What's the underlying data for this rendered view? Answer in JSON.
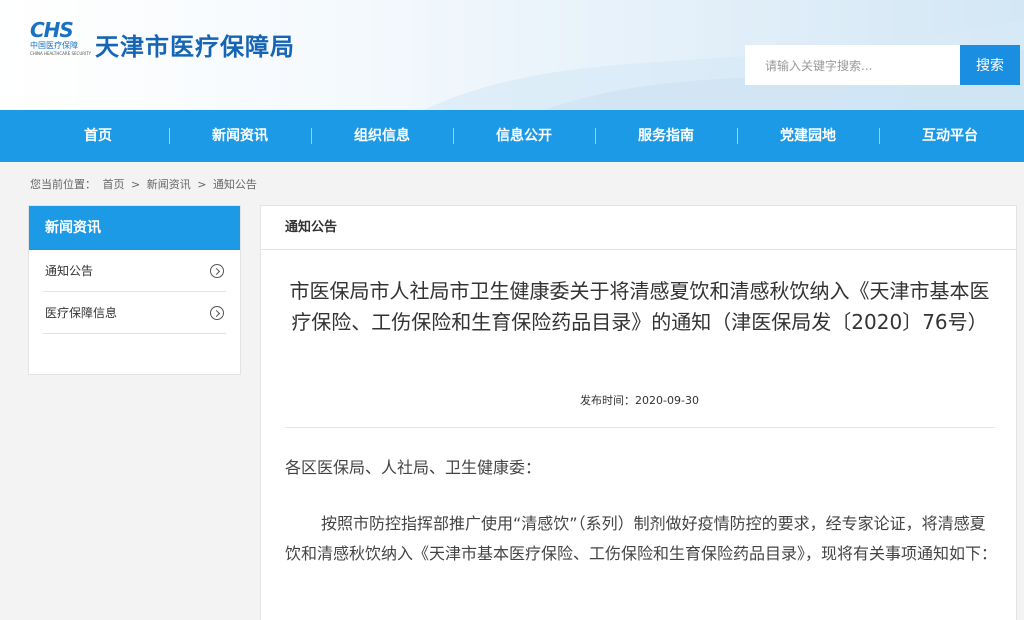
{
  "header": {
    "logo": {
      "mark": "CHS",
      "cn": "中国医疗保障",
      "en": "CHINA HEALTHCARE SECURITY"
    },
    "site_title": "天津市医疗保障局",
    "search": {
      "placeholder": "请输入关键字搜索...",
      "button": "搜索"
    }
  },
  "nav": {
    "items": [
      "首页",
      "新闻资讯",
      "组织信息",
      "信息公开",
      "服务指南",
      "党建园地",
      "互动平台"
    ]
  },
  "breadcrumb": {
    "prefix": "您当前位置：",
    "items": [
      "首页",
      "新闻资讯",
      "通知公告"
    ],
    "separator": ">"
  },
  "sidebar": {
    "title": "新闻资讯",
    "items": [
      "通知公告",
      "医疗保障信息"
    ]
  },
  "article": {
    "section": "通知公告",
    "title": "市医保局市人社局市卫生健康委关于将清感夏饮和清感秋饮纳入《天津市基本医疗保险、工伤保险和生育保险药品目录》的通知（津医保局发〔2020〕76号）",
    "publish_time": "发布时间：2020-09-30",
    "paragraphs": [
      "各区医保局、人社局、卫生健康委：",
      "按照市防控指挥部推广使用“清感饮”（系列）制剂做好疫情防控的要求，经专家论证，将清感夏饮和清感秋饮纳入《天津市基本医疗保险、工伤保险和生育保险药品目录》，现将有关事项通知如下："
    ]
  },
  "colors": {
    "primary": "#1d9ae6",
    "title_blue": "#1565b4",
    "search_button": "#1a8ee1"
  }
}
